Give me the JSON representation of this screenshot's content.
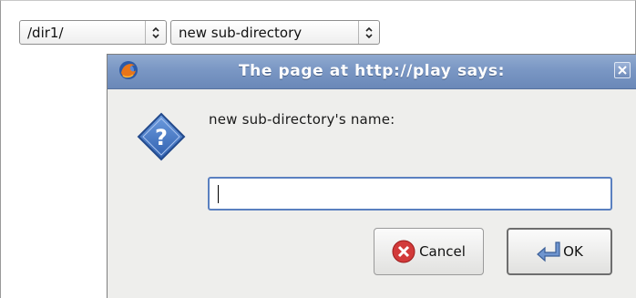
{
  "controls": {
    "dir_select": {
      "value": "/dir1/"
    },
    "subdir_select": {
      "value": "new sub-directory"
    }
  },
  "dialog": {
    "title": "The page at http://play says:",
    "prompt": "new sub-directory's name:",
    "input_value": "",
    "buttons": {
      "cancel": "Cancel",
      "ok": "OK"
    }
  },
  "icons": {
    "app": "firefox-icon",
    "close": "close-icon",
    "question": "question-icon",
    "cancel": "cancel-x-icon",
    "ok": "return-arrow-icon",
    "select_arrow": "chevron-updown-icon"
  },
  "colors": {
    "titlebar": "#7a97c4",
    "dialog_bg": "#eeeeec",
    "input_border": "#5a80c0",
    "question_blue": "#3a6cb8",
    "cancel_red": "#d23a3a"
  }
}
